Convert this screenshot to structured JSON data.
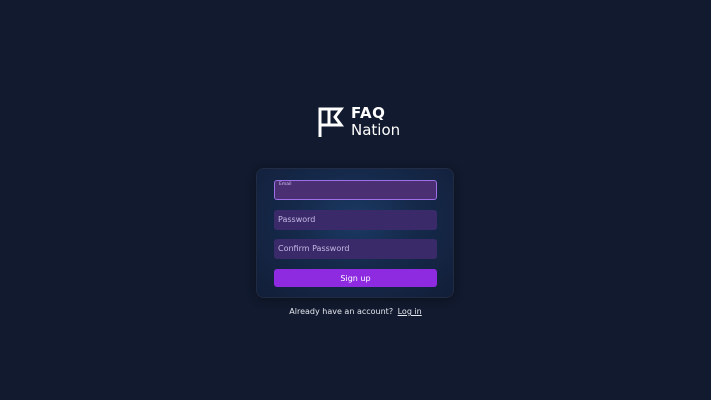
{
  "brand": {
    "name_line1": "FAQ",
    "name_line2": "Nation",
    "logo_icon": "flag-icon"
  },
  "form": {
    "email_label": "Email",
    "email_value": "",
    "password_placeholder": "Password",
    "confirm_password_placeholder": "Confirm Password",
    "submit_label": "Sign up"
  },
  "footer": {
    "prompt": "Already have an account?",
    "login_link": "Log in"
  },
  "colors": {
    "background": "#111a2e",
    "field": "#3a2a6a",
    "field_focus_border": "#9e6fe6",
    "button": "#8e2be0"
  }
}
